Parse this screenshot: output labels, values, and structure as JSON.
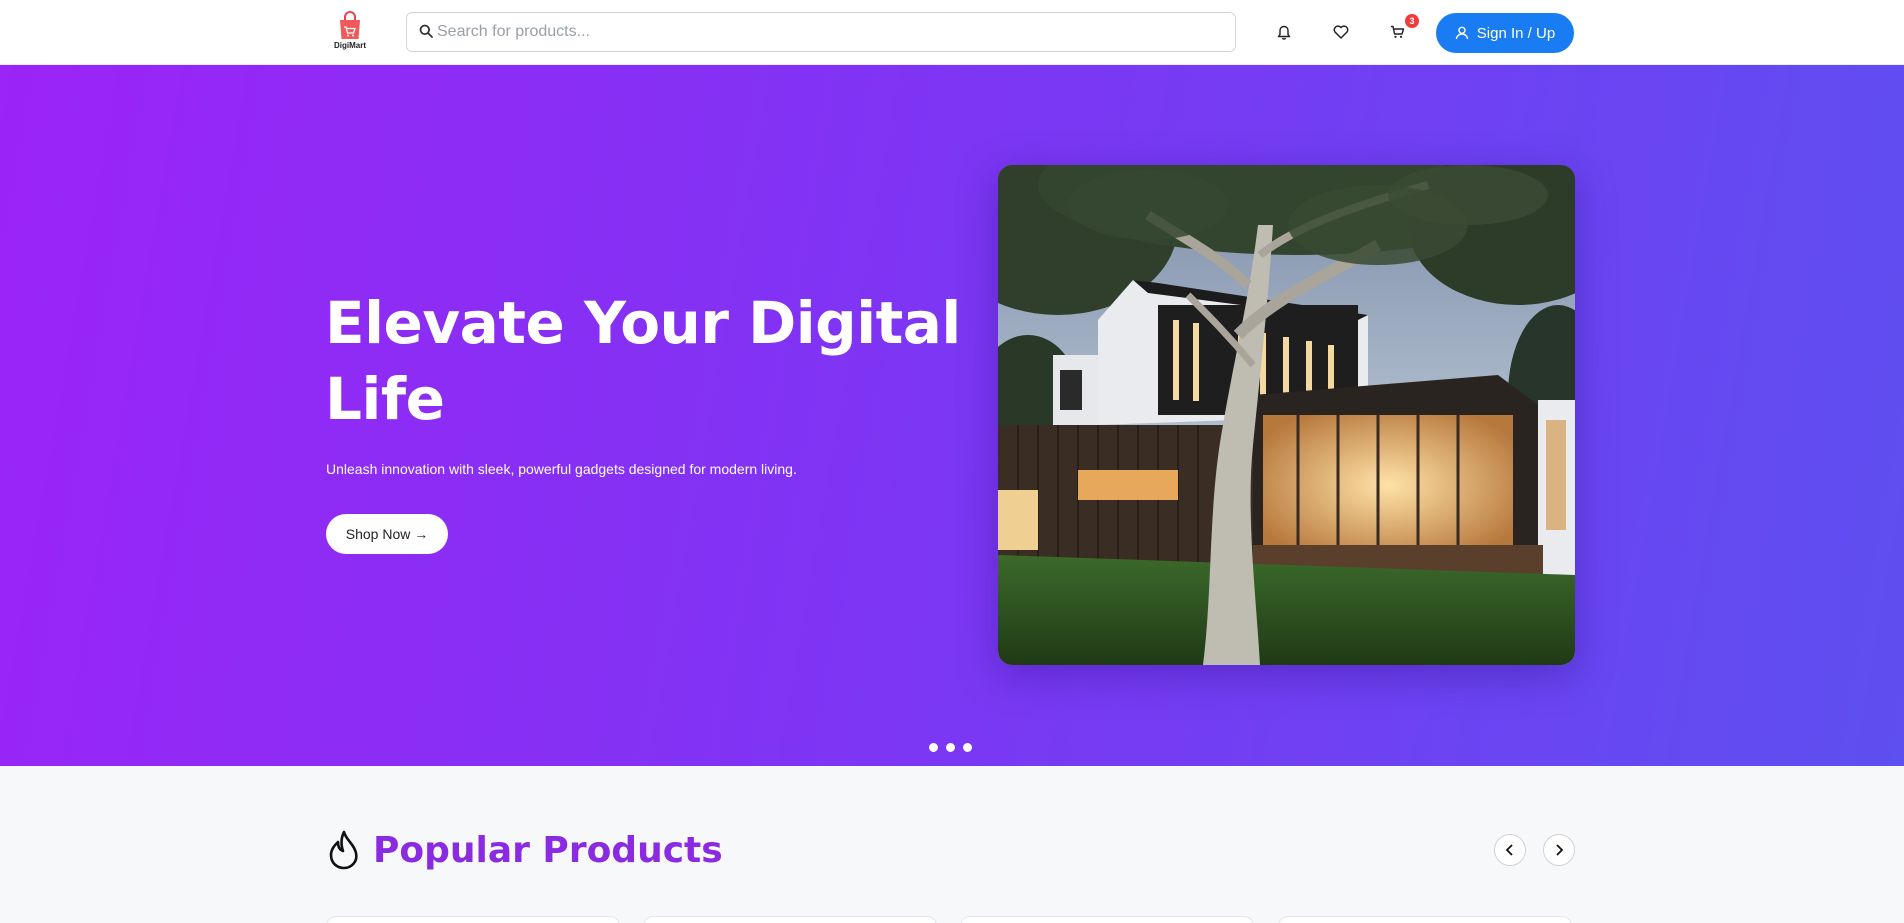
{
  "brand": {
    "name": "DigiMart",
    "accent": "#8a2be2",
    "primary": "#1a7cf2"
  },
  "header": {
    "search_placeholder": "Search for products...",
    "cart_count": "3",
    "signin_label": "Sign In / Up",
    "icons": [
      "bell-icon",
      "heart-icon",
      "cart-icon",
      "user-icon",
      "search-icon"
    ]
  },
  "hero": {
    "title": "Elevate Your Digital Life",
    "subtitle": "Unleash innovation with sleek, powerful gadgets designed for modern living.",
    "cta_label": "Shop Now →",
    "slide_count": 3
  },
  "popular": {
    "title": "Popular Products",
    "icon": "flame-icon"
  }
}
